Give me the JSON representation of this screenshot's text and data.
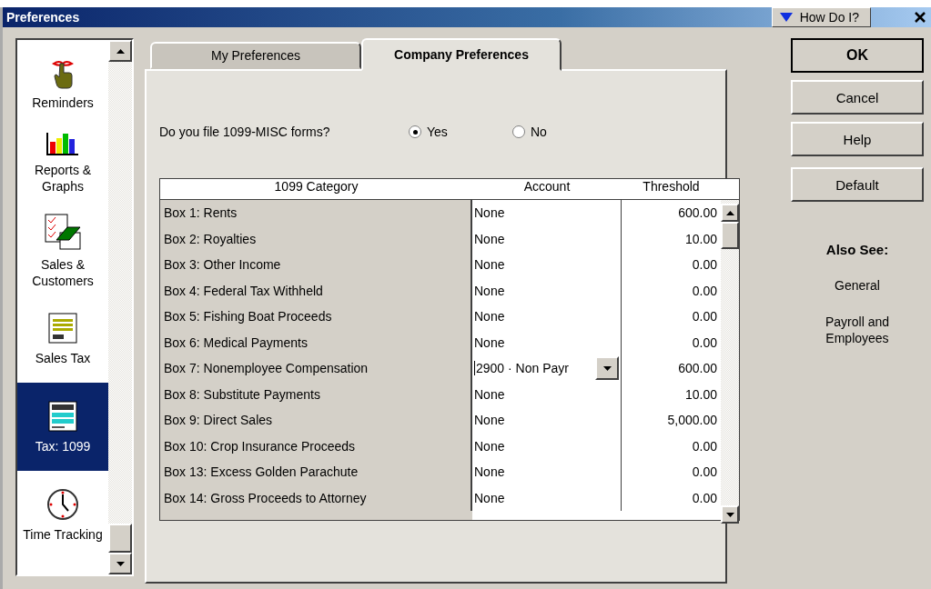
{
  "window": {
    "title": "Preferences",
    "help_button": "How Do I?"
  },
  "sidebar": {
    "items": [
      {
        "label": "Reminders",
        "selected": false
      },
      {
        "label": "Reports & Graphs",
        "selected": false
      },
      {
        "label": "Sales & Customers",
        "selected": false
      },
      {
        "label": "Sales Tax",
        "selected": false
      },
      {
        "label": "Tax: 1099",
        "selected": true
      },
      {
        "label": "Time Tracking",
        "selected": false
      }
    ]
  },
  "tabs": [
    {
      "label": "My Preferences",
      "selected": false
    },
    {
      "label": "Company Preferences",
      "selected": true
    }
  ],
  "question": {
    "label": "Do you file 1099-MISC forms?",
    "options": [
      {
        "label": "Yes",
        "selected": true
      },
      {
        "label": "No",
        "selected": false
      }
    ]
  },
  "table": {
    "columns": [
      "1099 Category",
      "Account",
      "Threshold"
    ],
    "rows": [
      {
        "category": "Box 1: Rents",
        "account": "None",
        "threshold": "600.00",
        "editing": false
      },
      {
        "category": "Box 2: Royalties",
        "account": "None",
        "threshold": "10.00",
        "editing": false
      },
      {
        "category": "Box 3: Other Income",
        "account": "None",
        "threshold": "0.00",
        "editing": false
      },
      {
        "category": "Box 4: Federal Tax Withheld",
        "account": "None",
        "threshold": "0.00",
        "editing": false
      },
      {
        "category": "Box 5: Fishing Boat Proceeds",
        "account": "None",
        "threshold": "0.00",
        "editing": false
      },
      {
        "category": "Box 6: Medical Payments",
        "account": "None",
        "threshold": "0.00",
        "editing": false
      },
      {
        "category": "Box 7: Nonemployee Compensation",
        "account": "2900 · Non Payr",
        "threshold": "600.00",
        "editing": true
      },
      {
        "category": "Box 8: Substitute Payments",
        "account": "None",
        "threshold": "10.00",
        "editing": false
      },
      {
        "category": "Box 9: Direct Sales",
        "account": "None",
        "threshold": "5,000.00",
        "editing": false
      },
      {
        "category": "Box 10: Crop Insurance Proceeds",
        "account": "None",
        "threshold": "0.00",
        "editing": false
      },
      {
        "category": "Box 13: Excess Golden Parachute",
        "account": "None",
        "threshold": "0.00",
        "editing": false
      },
      {
        "category": "Box 14: Gross Proceeds to Attorney",
        "account": "None",
        "threshold": "0.00",
        "editing": false
      }
    ]
  },
  "buttons": [
    {
      "label": "OK",
      "kind": "primary"
    },
    {
      "label": "Cancel",
      "kind": "normal"
    },
    {
      "label": "Help",
      "kind": "normal"
    },
    {
      "label": "Default",
      "kind": "spaced"
    }
  ],
  "also_see": {
    "title": "Also See:",
    "links": [
      "General",
      "Payroll and Employees"
    ]
  }
}
